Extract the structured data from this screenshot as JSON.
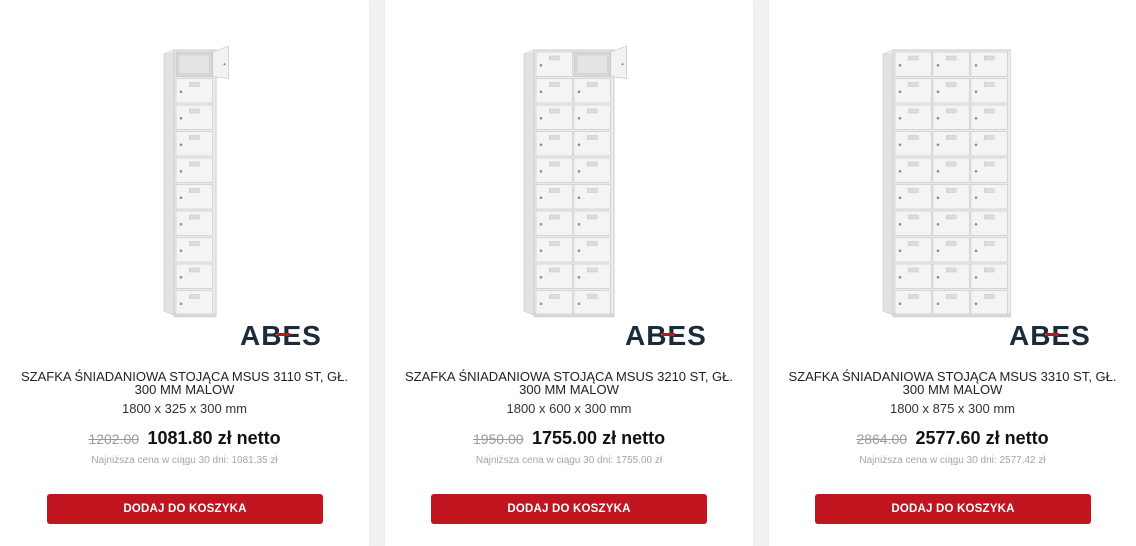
{
  "products": [
    {
      "title": "SZAFKA ŚNIADANIOWA STOJĄCA MSUS 3110 ST, GŁ. 300 MM MALOW",
      "dims": "1800 x 325 x 300 mm",
      "old_price": "1202.00",
      "new_price": "1081.80 zł netto",
      "lowest": "Najniższa cena w ciągu 30 dni: 1081.35 zł",
      "button": "DODAJ DO KOSZYKA",
      "brand": "ABES",
      "columns": 1
    },
    {
      "title": "SZAFKA ŚNIADANIOWA STOJĄCA MSUS 3210 ST, GŁ. 300 MM MALOW",
      "dims": "1800 x 600 x 300 mm",
      "old_price": "1950.00",
      "new_price": "1755.00 zł netto",
      "lowest": "Najniższa cena w ciągu 30 dni: 1755.00 zł",
      "button": "DODAJ DO KOSZYKA",
      "brand": "ABES",
      "columns": 2
    },
    {
      "title": "SZAFKA ŚNIADANIOWA STOJĄCA MSUS 3310 ST, GŁ. 300 MM MALOW",
      "dims": "1800 x 875 x 300 mm",
      "old_price": "2864.00",
      "new_price": "2577.60 zł netto",
      "lowest": "Najniższa cena w ciągu 30 dni: 2577.42 zł",
      "button": "DODAJ DO KOSZYKA",
      "brand": "ABES",
      "columns": 3
    }
  ],
  "colors": {
    "button_bg": "#c0151f",
    "brand_dark": "#1c2b3a",
    "brand_accent": "#c0151f",
    "old_price": "#9a9a9a",
    "lowest_price": "#a5a5a5"
  },
  "icons": [
    "locker-cabinet-image",
    "abes-logo"
  ]
}
